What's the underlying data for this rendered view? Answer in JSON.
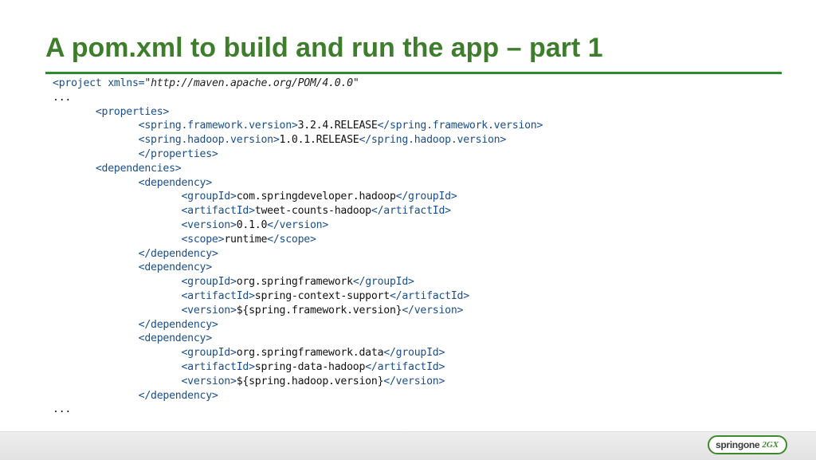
{
  "slide": {
    "title": "A pom.xml to build and run the app – part 1"
  },
  "code": {
    "lines": [
      {
        "indent": 0,
        "parts": [
          [
            "tag",
            "<project "
          ],
          [
            "attr",
            "xmlns"
          ],
          [
            "tag",
            "="
          ],
          [
            "str",
            "\"http://maven.apache.org/POM/4.0.0\""
          ]
        ]
      },
      {
        "indent": 0,
        "parts": [
          [
            "val",
            "..."
          ]
        ]
      },
      {
        "indent": 1,
        "parts": [
          [
            "tag",
            "<properties>"
          ]
        ]
      },
      {
        "indent": 2,
        "parts": [
          [
            "tag",
            "<spring.framework.version>"
          ],
          [
            "val",
            "3.2.4.RELEASE"
          ],
          [
            "tag",
            "</spring.framework.version>"
          ]
        ]
      },
      {
        "indent": 2,
        "parts": [
          [
            "tag",
            "<spring.hadoop.version>"
          ],
          [
            "val",
            "1.0.1.RELEASE"
          ],
          [
            "tag",
            "</spring.hadoop.version>"
          ]
        ]
      },
      {
        "indent": 2,
        "parts": [
          [
            "tag",
            "</properties>"
          ]
        ]
      },
      {
        "indent": 1,
        "parts": [
          [
            "tag",
            "<dependencies>"
          ]
        ]
      },
      {
        "indent": 2,
        "parts": [
          [
            "tag",
            "<dependency>"
          ]
        ]
      },
      {
        "indent": 3,
        "parts": [
          [
            "tag",
            "<groupId>"
          ],
          [
            "val",
            "com.springdeveloper.hadoop"
          ],
          [
            "tag",
            "</groupId>"
          ]
        ]
      },
      {
        "indent": 3,
        "parts": [
          [
            "tag",
            "<artifactId>"
          ],
          [
            "val",
            "tweet-counts-hadoop"
          ],
          [
            "tag",
            "</artifactId>"
          ]
        ]
      },
      {
        "indent": 3,
        "parts": [
          [
            "tag",
            "<version>"
          ],
          [
            "val",
            "0.1.0"
          ],
          [
            "tag",
            "</version>"
          ]
        ]
      },
      {
        "indent": 3,
        "parts": [
          [
            "tag",
            "<scope>"
          ],
          [
            "val",
            "runtime"
          ],
          [
            "tag",
            "</scope>"
          ]
        ]
      },
      {
        "indent": 2,
        "parts": [
          [
            "tag",
            "</dependency>"
          ]
        ]
      },
      {
        "indent": 2,
        "parts": [
          [
            "tag",
            "<dependency>"
          ]
        ]
      },
      {
        "indent": 3,
        "parts": [
          [
            "tag",
            "<groupId>"
          ],
          [
            "val",
            "org.springframework"
          ],
          [
            "tag",
            "</groupId>"
          ]
        ]
      },
      {
        "indent": 3,
        "parts": [
          [
            "tag",
            "<artifactId>"
          ],
          [
            "val",
            "spring-context-support"
          ],
          [
            "tag",
            "</artifactId>"
          ]
        ]
      },
      {
        "indent": 3,
        "parts": [
          [
            "tag",
            "<version>"
          ],
          [
            "val",
            "${spring.framework.version}"
          ],
          [
            "tag",
            "</version>"
          ]
        ]
      },
      {
        "indent": 2,
        "parts": [
          [
            "tag",
            "</dependency>"
          ]
        ]
      },
      {
        "indent": 2,
        "parts": [
          [
            "tag",
            "<dependency>"
          ]
        ]
      },
      {
        "indent": 3,
        "parts": [
          [
            "tag",
            "<groupId>"
          ],
          [
            "val",
            "org.springframework.data"
          ],
          [
            "tag",
            "</groupId>"
          ]
        ]
      },
      {
        "indent": 3,
        "parts": [
          [
            "tag",
            "<artifactId>"
          ],
          [
            "val",
            "spring-data-hadoop"
          ],
          [
            "tag",
            "</artifactId>"
          ]
        ]
      },
      {
        "indent": 3,
        "parts": [
          [
            "tag",
            "<version>"
          ],
          [
            "val",
            "${spring.hadoop.version}"
          ],
          [
            "tag",
            "</version>"
          ]
        ]
      },
      {
        "indent": 2,
        "parts": [
          [
            "tag",
            "</dependency>"
          ]
        ]
      },
      {
        "indent": 0,
        "parts": [
          [
            "val",
            "..."
          ]
        ]
      }
    ]
  },
  "footer": {
    "logo_text": "springone",
    "logo_suffix": "2GX"
  },
  "colors": {
    "title": "#3d7d2c",
    "rule": "#2f8a2a",
    "tag": "#1a4e8a"
  }
}
